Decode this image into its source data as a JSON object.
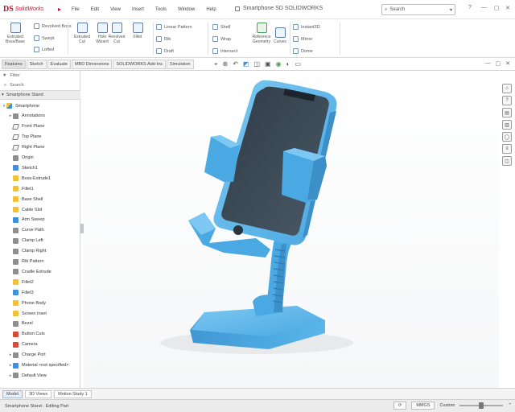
{
  "app": {
    "logo_mark": "DS",
    "logo_text": "SolidWorks",
    "doc_title": "Smartphone SD SOLIDWORKS",
    "search_placeholder": "Search"
  },
  "menu": [
    "File",
    "Edit",
    "View",
    "Insert",
    "Tools",
    "Window",
    "Help"
  ],
  "ribbon": {
    "group1": [
      {
        "label": "Extruded Boss/Base",
        "icon": "extrude-icon"
      },
      {
        "label": "Revolved Boss",
        "icon": "revolve-icon"
      },
      {
        "label": "Swept",
        "icon": "sweep-icon"
      },
      {
        "label": "Lofted",
        "icon": "loft-icon"
      }
    ],
    "group2": [
      {
        "label": "Extruded Cut",
        "icon": "cut-icon"
      },
      {
        "label": "Hole Wizard",
        "icon": "hole-icon"
      },
      {
        "label": "Revolved Cut",
        "icon": "revcut-icon"
      },
      {
        "label": "Fillet",
        "icon": "fillet-icon"
      }
    ],
    "group3": [
      "Linear Pattern",
      "Rib",
      "Draft"
    ],
    "group4": [
      "Shell",
      "Wrap",
      "Intersect"
    ],
    "group5": [
      "Reference Geometry",
      "Curves",
      "Instant3D"
    ],
    "group6": [
      "Mirror",
      "Dome"
    ]
  },
  "tabs": [
    "Features",
    "Sketch",
    "Evaluate",
    "MBD Dimensions",
    "SOLIDWORKS Add-Ins",
    "Simulation"
  ],
  "active_tab": 0,
  "tree": {
    "filter_label": "Filter",
    "search_label": "Search",
    "header": "Smartphone Stand",
    "items": [
      {
        "label": "Smartphone",
        "icon": "part",
        "indent": 0,
        "exp": "▾"
      },
      {
        "label": "Annotations",
        "icon": "gray",
        "indent": 1,
        "exp": "▸"
      },
      {
        "label": "Front Plane",
        "icon": "plane",
        "indent": 1,
        "exp": ""
      },
      {
        "label": "Top Plane",
        "icon": "plane",
        "indent": 1,
        "exp": ""
      },
      {
        "label": "Right Plane",
        "icon": "plane",
        "indent": 1,
        "exp": ""
      },
      {
        "label": "Origin",
        "icon": "gray",
        "indent": 1,
        "exp": ""
      },
      {
        "label": "Sketch1",
        "icon": "blue",
        "indent": 1,
        "exp": ""
      },
      {
        "label": "Boss-Extrude1",
        "icon": "yellow",
        "indent": 1,
        "exp": ""
      },
      {
        "label": "Fillet1",
        "icon": "yellow",
        "indent": 1,
        "exp": ""
      },
      {
        "label": "Base Shell",
        "icon": "yellow",
        "indent": 1,
        "exp": ""
      },
      {
        "label": "Cable Slot",
        "icon": "yellow",
        "indent": 1,
        "exp": ""
      },
      {
        "label": "Arm Sweep",
        "icon": "blue",
        "indent": 1,
        "exp": ""
      },
      {
        "label": "Curve Path",
        "icon": "gray",
        "indent": 1,
        "exp": ""
      },
      {
        "label": "Clamp Left",
        "icon": "gray",
        "indent": 1,
        "exp": ""
      },
      {
        "label": "Clamp Right",
        "icon": "gray",
        "indent": 1,
        "exp": ""
      },
      {
        "label": "Rib Pattern",
        "icon": "gray",
        "indent": 1,
        "exp": ""
      },
      {
        "label": "Cradle Extrude",
        "icon": "gray",
        "indent": 1,
        "exp": ""
      },
      {
        "label": "Fillet2",
        "icon": "yellow",
        "indent": 1,
        "exp": ""
      },
      {
        "label": "Fillet3",
        "icon": "blue",
        "indent": 1,
        "exp": ""
      },
      {
        "label": "Phone Body",
        "icon": "yellow",
        "indent": 1,
        "exp": ""
      },
      {
        "label": "Screen Inset",
        "icon": "yellow",
        "indent": 1,
        "exp": ""
      },
      {
        "label": "Bezel",
        "icon": "gray",
        "indent": 1,
        "exp": ""
      },
      {
        "label": "Button Cuts",
        "icon": "red",
        "indent": 1,
        "exp": ""
      },
      {
        "label": "Camera",
        "icon": "red",
        "indent": 1,
        "exp": ""
      },
      {
        "label": "Charge Port",
        "icon": "gray",
        "indent": 1,
        "exp": "▸"
      },
      {
        "label": "Material <not specified>",
        "icon": "blue",
        "indent": 1,
        "exp": "▸"
      },
      {
        "label": "Default View",
        "icon": "gray",
        "indent": 1,
        "exp": "▸"
      }
    ]
  },
  "bottom_tabs": [
    "Model",
    "3D Views",
    "Motion Study 1"
  ],
  "status": {
    "text": "Smartphone Stand - Editing Part",
    "units": "MMGS",
    "custom": "Custom"
  },
  "colors": {
    "model_blue": "#5ab6ea",
    "brand_red": "#c8102e"
  }
}
